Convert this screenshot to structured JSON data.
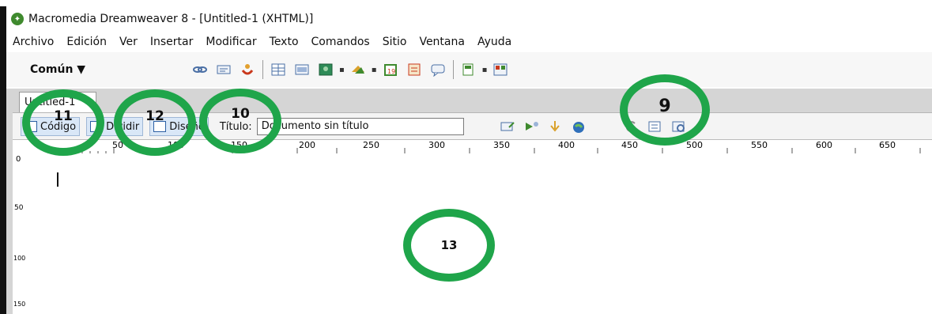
{
  "window": {
    "title": "Macromedia Dreamweaver 8 - [Untitled-1 (XHTML)]"
  },
  "menubar": {
    "items": [
      "Archivo",
      "Edición",
      "Ver",
      "Insertar",
      "Modificar",
      "Texto",
      "Comandos",
      "Sitio",
      "Ventana",
      "Ayuda"
    ]
  },
  "insert_bar": {
    "category": "Común",
    "icons": [
      "hyperlink-icon",
      "email-link-icon",
      "named-anchor-icon",
      "table-icon",
      "layer-icon",
      "image-icon",
      "media-icon",
      "date-icon",
      "server-include-icon",
      "comment-icon",
      "templates-icon",
      "tag-chooser-icon"
    ]
  },
  "document": {
    "tab_label": "Untitled-1",
    "view_buttons": {
      "code": "Código",
      "split": "Dividir",
      "design": "Diseño"
    },
    "title_label": "Título:",
    "title_value": "Documento sin título",
    "toolbar_icons": [
      "file-management-icon",
      "preview-browser-icon",
      "refresh-design-icon",
      "view-options-icon",
      "visual-aids-icon",
      "validate-icon",
      "check-browser-icon"
    ]
  },
  "ruler": {
    "ticks": [
      "50",
      "100",
      "150",
      "200",
      "250",
      "300",
      "350",
      "400",
      "450",
      "500",
      "550",
      "600",
      "650"
    ],
    "vertical_ticks": [
      "0",
      "50",
      "100",
      "150"
    ]
  },
  "annotations": [
    "11",
    "12",
    "10",
    "9",
    "13"
  ],
  "colors": {
    "annotation_circle": "#1fa54a",
    "view_button_bg": "#d9e7f7",
    "app_icon": "#3f8a2e"
  }
}
